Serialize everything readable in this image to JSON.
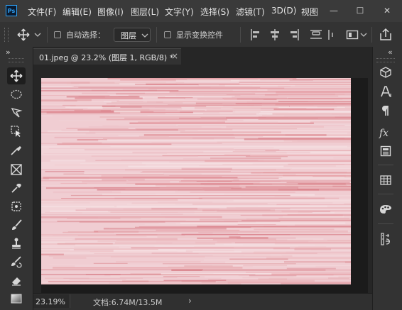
{
  "app": {
    "logo_text": "Ps"
  },
  "menu": {
    "items": [
      "文件(F)",
      "编辑(E)",
      "图像(I)",
      "图层(L)",
      "文字(Y)",
      "选择(S)",
      "滤镜(T)",
      "3D(D)",
      "视图"
    ]
  },
  "window_controls": {
    "minimize": "—",
    "maximize": "☐",
    "close": "✕"
  },
  "options": {
    "auto_select_label": "自动选择：",
    "layer_select_value": "图层",
    "show_transform_label": "显示变换控件"
  },
  "document": {
    "tab_title": "01.jpeg @ 23.2% (图层 1, RGB/8) *",
    "close_glyph": "×"
  },
  "status": {
    "zoom": "23.19%",
    "doc_info": "文档:6.74M/13.5M",
    "arrow": "›"
  },
  "panels": {
    "collapse_left": "»",
    "collapse_right": "«"
  },
  "colors": {
    "accent": "#2fa3f7",
    "image_base": "#f0cdd2",
    "image_stripe": "#e7a2a8"
  },
  "icons": {
    "left_tools": [
      "move-icon",
      "elliptical-marquee-icon",
      "lasso-icon",
      "object-selection-icon",
      "crop-icon",
      "frame-icon",
      "eyedropper-icon",
      "healing-brush-icon",
      "brush-icon",
      "clone-stamp-icon",
      "history-brush-icon",
      "eraser-icon",
      "gradient-icon"
    ],
    "right_tools": [
      "3d-icon",
      "character-icon",
      "paragraph-icon",
      "fx-icon",
      "properties-icon",
      "swatches-icon",
      "color-icon",
      "adjustments-icon"
    ]
  }
}
